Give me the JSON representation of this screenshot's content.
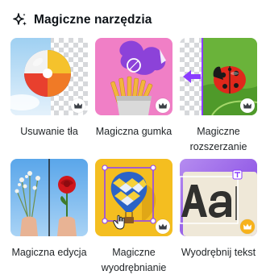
{
  "section": {
    "title": "Magiczne narzędzia",
    "icon": "magic-sparkle-icon"
  },
  "tools": [
    {
      "label": "Usuwanie tła",
      "icon": "beach-ball-icon",
      "badge": "crown-icon"
    },
    {
      "label": "Magiczna gumka",
      "icon": "fries-icon",
      "badge": "crown-icon"
    },
    {
      "label": "Magiczne rozszerzanie",
      "icon": "ladybug-icon",
      "badge": "crown-icon"
    },
    {
      "label": "Magiczna edycja",
      "icon": "flower-hand-icon",
      "badge": "none"
    },
    {
      "label": "Magiczne wyodrębnianie",
      "icon": "hot-air-balloon-icon",
      "badge": "crown-icon"
    },
    {
      "label": "Wyodrębnij tekst",
      "icon": "text-aa-icon",
      "badge": "crown-icon-gold"
    }
  ],
  "colors": {
    "title": "#0e1318",
    "purple_accent": "#8b3dff",
    "pink_bg": "#f07fc6",
    "yellow_bg": "#f4be20",
    "sky_bg": "#6fb1ea",
    "gold_badge": "#f7b21a"
  }
}
